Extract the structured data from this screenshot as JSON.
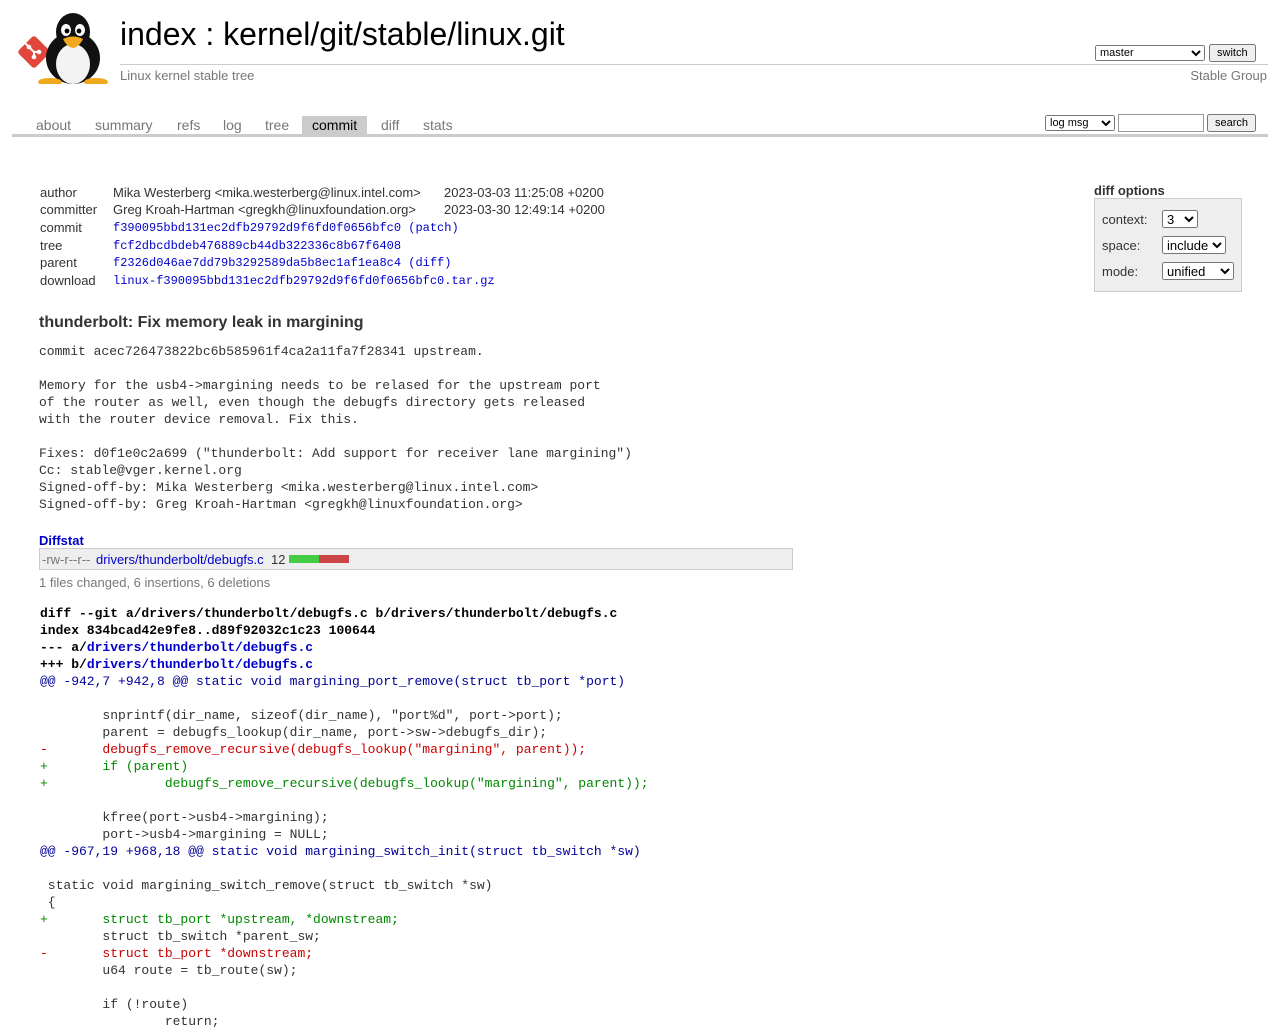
{
  "header": {
    "title_index": "index",
    "title_separator": " : ",
    "title_repo": "kernel/git/stable/linux.git",
    "subtitle": "Linux kernel stable tree",
    "owner": "Stable Group",
    "branch_selected": "master",
    "switch_label": "switch",
    "logo_icons": [
      "git-logo-icon",
      "tux-penguin-icon"
    ]
  },
  "tabs": [
    "about",
    "summary",
    "refs",
    "log",
    "tree",
    "commit",
    "diff",
    "stats"
  ],
  "active_tab": "commit",
  "search": {
    "type_selected": "log msg",
    "query": "",
    "button_label": "search"
  },
  "diff_options": {
    "title": "diff options",
    "context_label": "context:",
    "context_value": "3",
    "space_label": "space:",
    "space_value": "include",
    "mode_label": "mode:",
    "mode_value": "unified"
  },
  "commit_info": {
    "author_label": "author",
    "author": "Mika Westerberg <mika.westerberg@linux.intel.com>",
    "author_date": "2023-03-03 11:25:08 +0200",
    "committer_label": "committer",
    "committer": "Greg Kroah-Hartman <gregkh@linuxfoundation.org>",
    "committer_date": "2023-03-30 12:49:14 +0200",
    "commit_label": "commit",
    "commit_hash": "f390095bbd131ec2dfb29792d9f6fd0f0656bfc0",
    "commit_extra": "(patch)",
    "tree_label": "tree",
    "tree_hash": "fcf2dbcdbdeb476889cb44db322336c8b67f6408",
    "parent_label": "parent",
    "parent_hash": "f2326d046ae7dd79b3292589da5b8ec1af1ea8c4",
    "parent_extra": "(diff)",
    "download_label": "download",
    "download_file": "linux-f390095bbd131ec2dfb29792d9f6fd0f0656bfc0.tar.gz"
  },
  "commit_subject": "thunderbolt: Fix memory leak in margining",
  "commit_message": "commit acec726473822bc6b585961f4ca2a11fa7f28341 upstream.\n\nMemory for the usb4->margining needs to be relased for the upstream port\nof the router as well, even though the debugfs directory gets released\nwith the router device removal. Fix this.\n\nFixes: d0f1e0c2a699 (\"thunderbolt: Add support for receiver lane margining\")\nCc: stable@vger.kernel.org\nSigned-off-by: Mika Westerberg <mika.westerberg@linux.intel.com>\nSigned-off-by: Greg Kroah-Hartman <gregkh@linuxfoundation.org>",
  "diffstat": {
    "header": "Diffstat",
    "mode": "-rw-r--r--",
    "file": "drivers/thunderbolt/debugfs.c",
    "count": "12",
    "insertions": 6,
    "deletions": 6,
    "summary": "1 files changed, 6 insertions, 6 deletions",
    "colors": {
      "insert": "#44cc44",
      "delete": "#cc4444"
    }
  },
  "diff": {
    "header_line1": "diff --git a/drivers/thunderbolt/debugfs.c b/drivers/thunderbolt/debugfs.c",
    "header_line2": "index 834bcad42e9fe8..d89f92032c1c23 100644",
    "minus_prefix": "--- a/",
    "plus_prefix": "+++ b/",
    "file_path": "drivers/thunderbolt/debugfs.c",
    "lines": [
      {
        "type": "hunk",
        "text": "@@ -942,7 +942,8 @@ static void margining_port_remove(struct tb_port *port)"
      },
      {
        "type": "ctx",
        "text": " "
      },
      {
        "type": "ctx",
        "text": " \tsnprintf(dir_name, sizeof(dir_name), \"port%d\", port->port);"
      },
      {
        "type": "ctx",
        "text": " \tparent = debugfs_lookup(dir_name, port->sw->debugfs_dir);"
      },
      {
        "type": "del",
        "text": "-\tdebugfs_remove_recursive(debugfs_lookup(\"margining\", parent));"
      },
      {
        "type": "add",
        "text": "+\tif (parent)"
      },
      {
        "type": "add",
        "text": "+\t\tdebugfs_remove_recursive(debugfs_lookup(\"margining\", parent));"
      },
      {
        "type": "ctx",
        "text": " "
      },
      {
        "type": "ctx",
        "text": " \tkfree(port->usb4->margining);"
      },
      {
        "type": "ctx",
        "text": " \tport->usb4->margining = NULL;"
      },
      {
        "type": "hunk",
        "text": "@@ -967,19 +968,18 @@ static void margining_switch_init(struct tb_switch *sw)"
      },
      {
        "type": "ctx",
        "text": " "
      },
      {
        "type": "ctx",
        "text": " static void margining_switch_remove(struct tb_switch *sw)"
      },
      {
        "type": "ctx",
        "text": " {"
      },
      {
        "type": "add",
        "text": "+\tstruct tb_port *upstream, *downstream;"
      },
      {
        "type": "ctx",
        "text": " \tstruct tb_switch *parent_sw;"
      },
      {
        "type": "del",
        "text": "-\tstruct tb_port *downstream;"
      },
      {
        "type": "ctx",
        "text": " \tu64 route = tb_route(sw);"
      },
      {
        "type": "ctx",
        "text": " "
      },
      {
        "type": "ctx",
        "text": " \tif (!route)"
      },
      {
        "type": "ctx",
        "text": " \t\treturn;"
      }
    ]
  }
}
